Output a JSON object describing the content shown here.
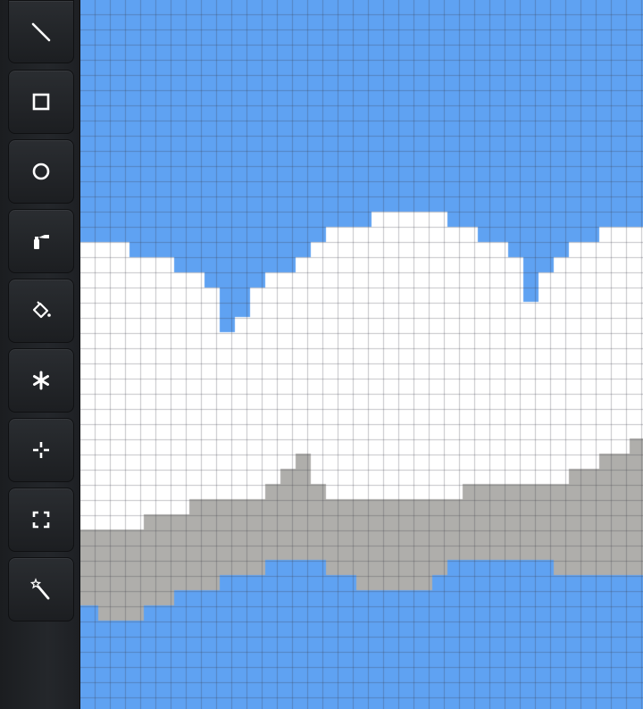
{
  "canvas": {
    "cols": 42,
    "rows": 47,
    "colors": {
      "sky": "#5fa2f2",
      "cloud": "#ffffff",
      "shadow": "#afaeab",
      "grid": "rgba(60,60,70,0.30)"
    }
  },
  "toolbar": {
    "tools": [
      {
        "id": "line",
        "icon": "line-icon"
      },
      {
        "id": "rectangle",
        "icon": "square-icon"
      },
      {
        "id": "ellipse",
        "icon": "circle-icon"
      },
      {
        "id": "spray",
        "icon": "spray-can-icon"
      },
      {
        "id": "fill",
        "icon": "paint-bucket-icon"
      },
      {
        "id": "brush",
        "icon": "asterisk-icon"
      },
      {
        "id": "move",
        "icon": "move-icon"
      },
      {
        "id": "select",
        "icon": "selection-icon"
      },
      {
        "id": "magic-wand",
        "icon": "magic-wand-icon"
      }
    ]
  }
}
